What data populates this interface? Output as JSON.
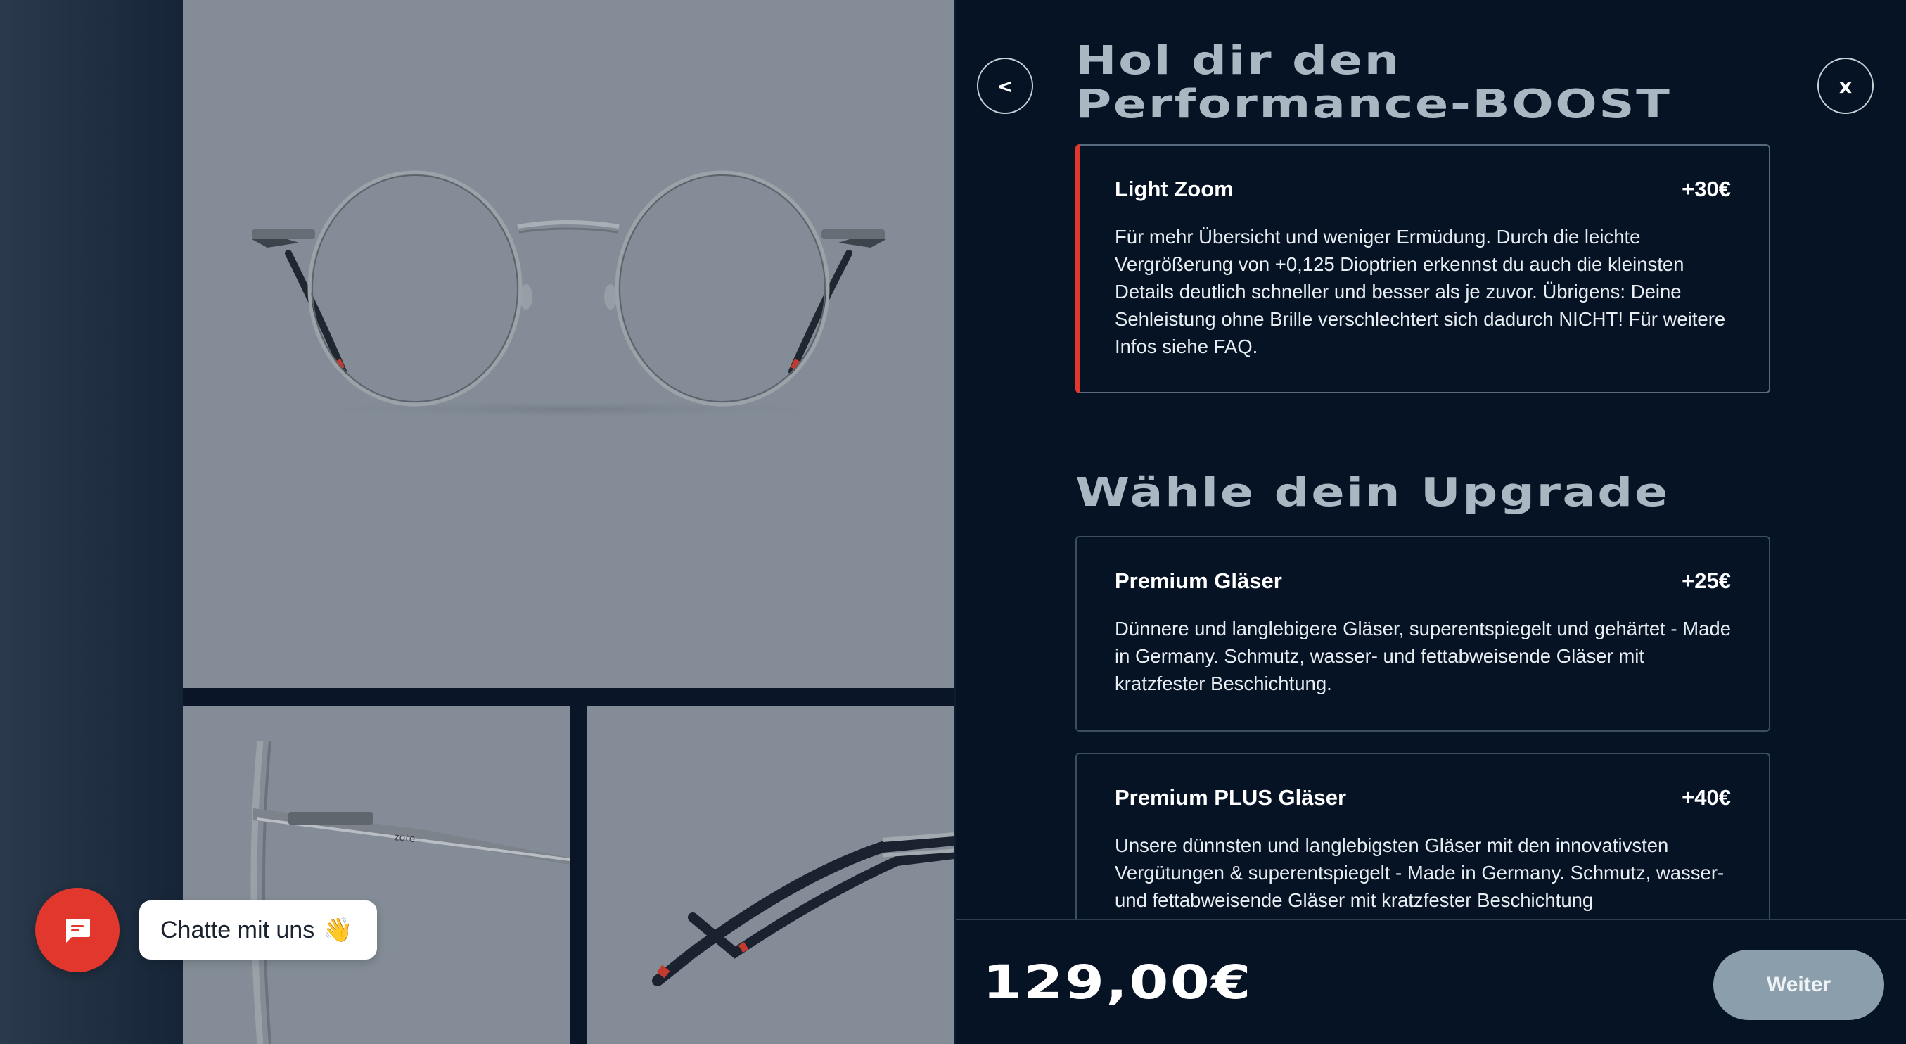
{
  "header": {
    "title_line1": "Hol dir den",
    "title_line2": "Performance-BOOST",
    "back_label": "<",
    "close_label": "x"
  },
  "boost_option": {
    "name": "Light Zoom",
    "price": "+30€",
    "description": "Für mehr Übersicht und weniger Ermüdung. Durch die leichte Vergrößerung von +0,125 Dioptrien erkennst du auch die kleinsten Details deutlich schneller und besser als je zuvor. Übrigens: Deine Sehleistung ohne Brille verschlechtert sich dadurch NICHT! Für weitere Infos siehe FAQ.",
    "selected": true
  },
  "upgrade_section": {
    "title": "Wähle dein Upgrade",
    "options": [
      {
        "name": "Premium Gläser",
        "price": "+25€",
        "description": "Dünnere und langlebigere Gläser, superentspiegelt und gehärtet - Made in Germany. Schmutz, wasser- und fettabweisende Gläser mit kratzfester Beschichtung."
      },
      {
        "name": "Premium PLUS Gläser",
        "price": "+40€",
        "description": "Unsere dünnsten und langlebigsten Gläser mit den innovativsten Vergütungen & superentspiegelt - Made in Germany. Schmutz, wasser- und fettabweisende Gläser mit kratzfester Beschichtung"
      }
    ]
  },
  "footer": {
    "total_price": "129,00€",
    "next_label": "Weiter"
  },
  "chat": {
    "label": "Chatte mit uns",
    "emoji": "👋"
  },
  "colors": {
    "panel_bg": "#061325",
    "accent_red": "#e2372c",
    "heading_color": "#a9b7c3",
    "next_button": "#8a9eac",
    "image_bg": "#848d97"
  }
}
